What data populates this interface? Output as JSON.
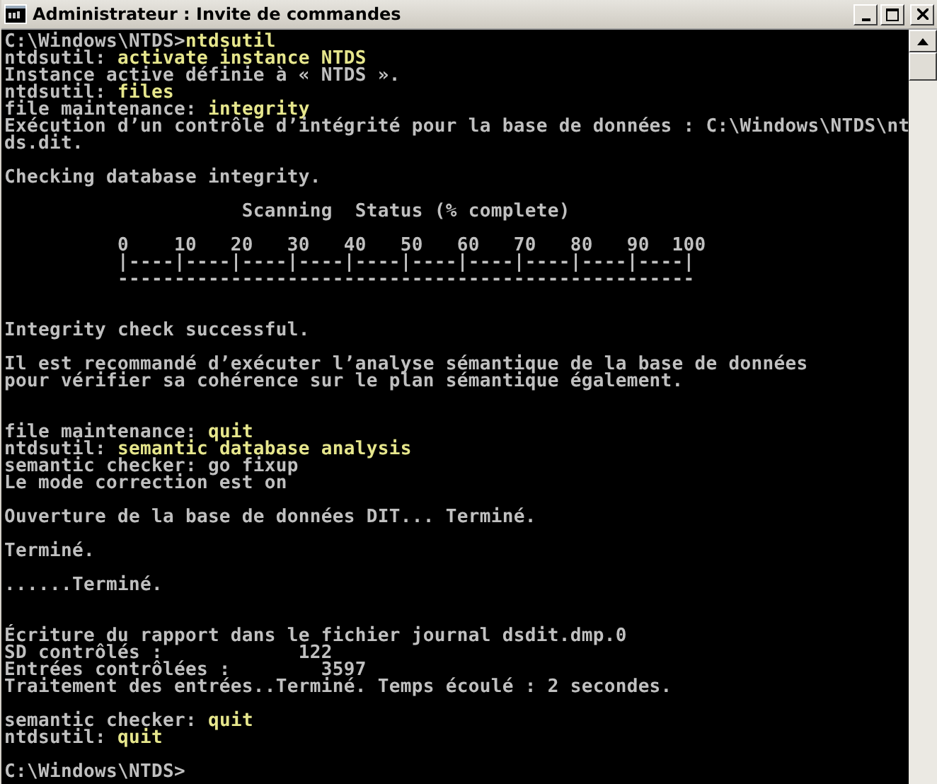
{
  "window": {
    "title": "Administrateur : Invite de commandes"
  },
  "console": {
    "lines": [
      {
        "kind": "prompt",
        "text": "C:\\Windows\\NTDS>",
        "input": "ntdsutil"
      },
      {
        "kind": "prompt",
        "text": "ntdsutil: ",
        "input": "activate instance NTDS"
      },
      {
        "kind": "output",
        "text": "Instance active définie à « NTDS »."
      },
      {
        "kind": "prompt",
        "text": "ntdsutil: ",
        "input": "files"
      },
      {
        "kind": "prompt",
        "text": "file maintenance: ",
        "input": "integrity"
      },
      {
        "kind": "output",
        "text": "Exécution d’un contrôle d’intégrité pour la base de données : C:\\Windows\\NTDS\\nt"
      },
      {
        "kind": "output",
        "text": "ds.dit."
      },
      {
        "kind": "blank"
      },
      {
        "kind": "output",
        "text": "Checking database integrity."
      },
      {
        "kind": "blank"
      },
      {
        "kind": "output",
        "text": "                     Scanning  Status (% complete)"
      },
      {
        "kind": "blank"
      },
      {
        "kind": "output",
        "text": "          0    10   20   30   40   50   60   70   80   90  100"
      },
      {
        "kind": "output",
        "text": "          |----|----|----|----|----|----|----|----|----|----|"
      },
      {
        "kind": "output",
        "text": "          ---------------------------------------------------"
      },
      {
        "kind": "blank"
      },
      {
        "kind": "blank"
      },
      {
        "kind": "output",
        "text": "Integrity check successful."
      },
      {
        "kind": "blank"
      },
      {
        "kind": "output",
        "text": "Il est recommandé d’exécuter l’analyse sémantique de la base de données"
      },
      {
        "kind": "output",
        "text": "pour vérifier sa cohérence sur le plan sémantique également."
      },
      {
        "kind": "blank"
      },
      {
        "kind": "blank"
      },
      {
        "kind": "prompt",
        "text": "file maintenance: ",
        "input": "quit"
      },
      {
        "kind": "prompt",
        "text": "ntdsutil: ",
        "input": "semantic database analysis"
      },
      {
        "kind": "output",
        "text": "semantic checker: go fixup"
      },
      {
        "kind": "output",
        "text": "Le mode correction est on"
      },
      {
        "kind": "blank"
      },
      {
        "kind": "output",
        "text": "Ouverture de la base de données DIT... Terminé."
      },
      {
        "kind": "blank"
      },
      {
        "kind": "output",
        "text": "Terminé."
      },
      {
        "kind": "blank"
      },
      {
        "kind": "output",
        "text": "......Terminé."
      },
      {
        "kind": "blank"
      },
      {
        "kind": "blank"
      },
      {
        "kind": "output",
        "text": "Écriture du rapport dans le fichier journal dsdit.dmp.0"
      },
      {
        "kind": "output",
        "text": "SD contrôlés :            122"
      },
      {
        "kind": "output",
        "text": "Entrées contrôlées :        3597"
      },
      {
        "kind": "output",
        "text": "Traitement des entrées..Terminé. Temps écoulé : 2 secondes."
      },
      {
        "kind": "blank"
      },
      {
        "kind": "prompt",
        "text": "semantic checker: ",
        "input": "quit"
      },
      {
        "kind": "prompt",
        "text": "ntdsutil: ",
        "input": "quit"
      },
      {
        "kind": "blank"
      },
      {
        "kind": "prompt",
        "text": "C:\\Windows\\NTDS>"
      }
    ]
  }
}
